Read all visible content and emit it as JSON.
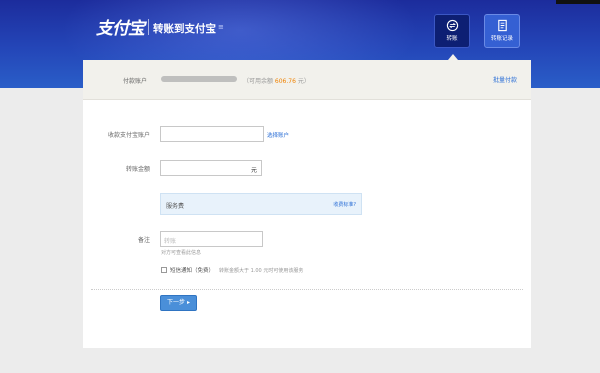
{
  "header": {
    "logo_text": "支付宝",
    "page_title": "转账到支付宝",
    "title_caret": "≡",
    "nav": [
      {
        "label": "转账",
        "icon": "transfer-icon",
        "active": true
      },
      {
        "label": "转账记录",
        "icon": "records-icon",
        "active": false
      }
    ]
  },
  "payer": {
    "label": "付款账户",
    "balance_prefix": "（可用余额 ",
    "balance_amount": "606.76",
    "balance_suffix": " 元）",
    "batch_link": "批量付款"
  },
  "form": {
    "recipient_label": "收款支付宝账户",
    "recipient_value": "",
    "choose_account_link": "选择账户",
    "amount_label": "转账金额",
    "amount_value": "",
    "amount_unit": "元",
    "fee_label": "服务费",
    "fee_link": "收费标准?",
    "remark_label": "备注",
    "remark_placeholder": "转账",
    "remark_hint": "对方可查看此信息",
    "notify_label": "短信通知（免费）",
    "notify_note": "转账金额大于 1.00 元时可使用该服务",
    "next_button": "下一步 ▸"
  },
  "colors": {
    "header_bg": "#2446b8",
    "link": "#2c6fd6",
    "balance": "#f08200",
    "button": "#4a8fd9"
  }
}
